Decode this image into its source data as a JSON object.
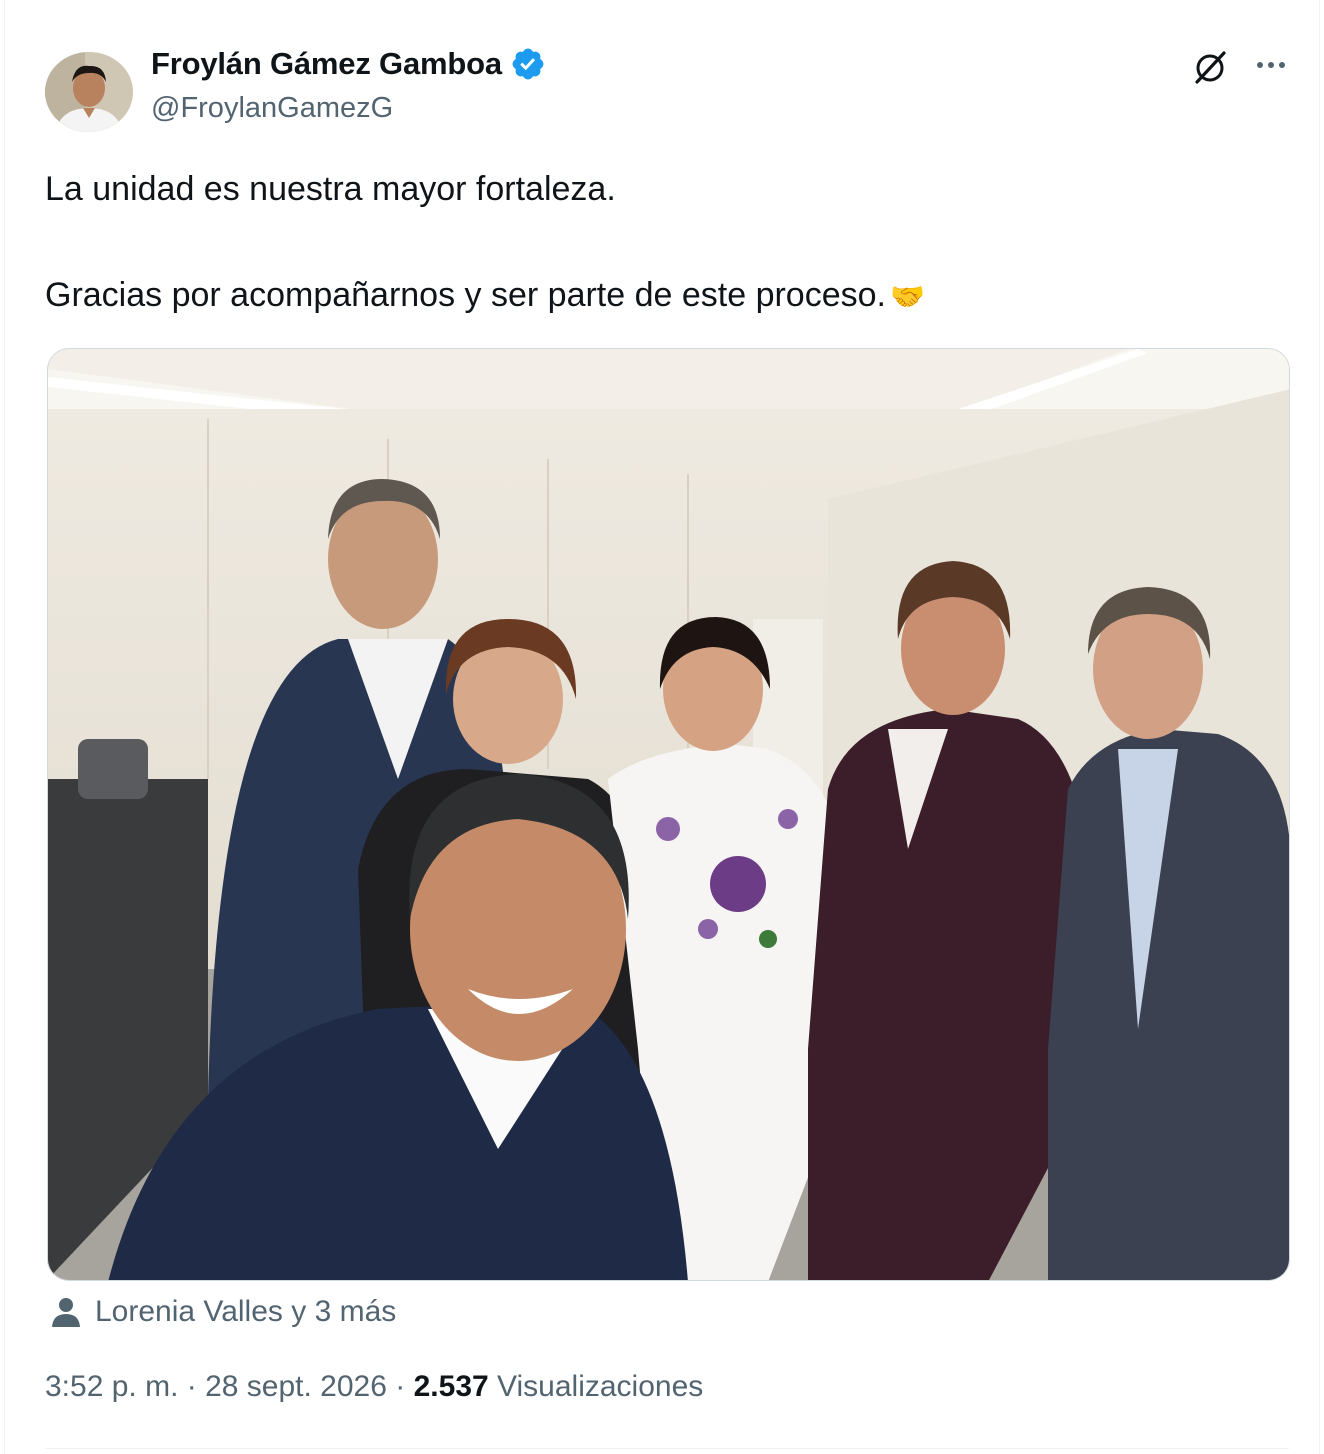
{
  "author": {
    "name": "Froylán Gámez Gamboa",
    "handle": "@FroylanGamezG",
    "verified_color": "#1d9bf0"
  },
  "tweet": {
    "line1": "La unidad es nuestra mayor fortaleza.",
    "line2": "Gracias por acompañarnos y ser parte de este proceso.",
    "emoji": "🤝"
  },
  "tags": {
    "text": "Lorenia Valles y 3 más"
  },
  "meta": {
    "time": "3:52 p. m.",
    "separator": "·",
    "date": "28 sept. 2026",
    "views_count": "2.537",
    "views_label": "Visualizaciones"
  },
  "icons": {
    "grok": "grok-slash-icon",
    "more": "more-dots-icon",
    "verified": "verified-badge-icon",
    "person": "person-icon"
  }
}
